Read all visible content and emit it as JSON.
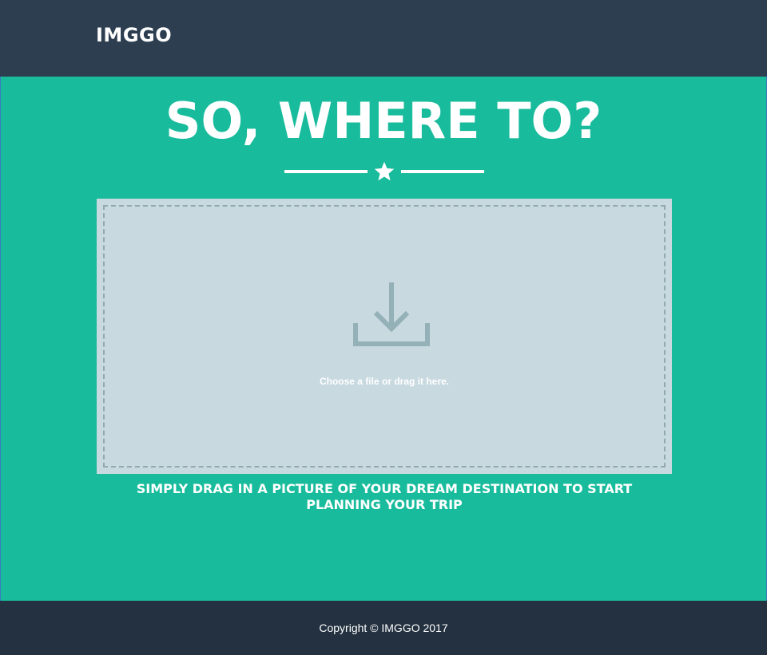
{
  "navbar": {
    "brand": "IMGGO"
  },
  "hero": {
    "headline": "SO, WHERE TO?",
    "divider_icon": "star-icon"
  },
  "dropzone": {
    "icon": "download-icon",
    "text": "Choose a file or drag it here."
  },
  "tagline": "SIMPLY DRAG IN A PICTURE OF YOUR DREAM DESTINATION TO START PLANNING YOUR TRIP",
  "footer": {
    "copyright": "Copyright © IMGGO 2017"
  },
  "colors": {
    "navbar": "#2c3e50",
    "accent": "#18bc9c",
    "dropzone": "#c8d9e0",
    "footer": "#233140"
  }
}
